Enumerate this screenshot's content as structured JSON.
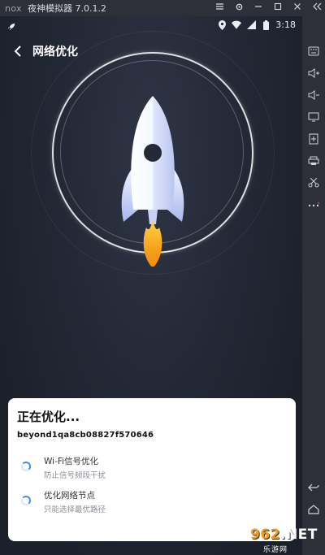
{
  "emulator": {
    "logo": "nox",
    "title": "夜神模拟器 7.0.1.2"
  },
  "status_bar": {
    "time": "3:18"
  },
  "header": {
    "title": "网络优化"
  },
  "sheet": {
    "title": "正在优化...",
    "device_name": "beyond1qa8cb08827f570646",
    "tasks": [
      {
        "title": "Wi-Fi信号优化",
        "subtitle": "防止信号频段干扰"
      },
      {
        "title": "优化网络节点",
        "subtitle": "只能选择最优路径"
      }
    ]
  },
  "watermark": {
    "main": "962",
    "suffix": ".NET",
    "sub": "乐游网"
  },
  "colors": {
    "accent": "#3a8ee6",
    "background": "#242937",
    "flame": "#f7a21b"
  }
}
